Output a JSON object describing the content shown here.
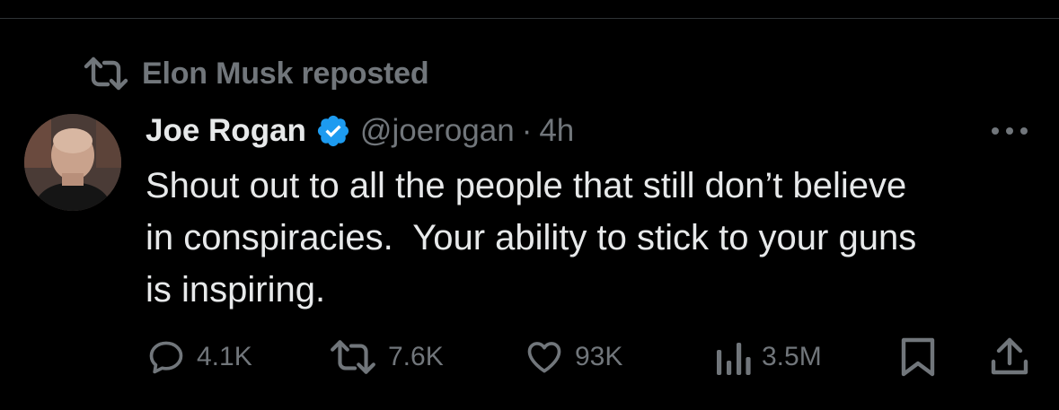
{
  "repost": {
    "text": "Elon Musk reposted",
    "icon": "repost-icon"
  },
  "tweet": {
    "display_name": "Joe Rogan",
    "verified_icon": "verified-badge-icon",
    "handle": "@joerogan",
    "separator": "·",
    "time": "4h",
    "text": "Shout out to all the people that still don’t believe\nin conspiracies.  Your ability to stick to your guns\nis inspiring.",
    "more_icon": "more-icon"
  },
  "actions": {
    "replies": "4.1K",
    "reposts": "7.6K",
    "likes": "93K",
    "views": "3.5M",
    "icons": [
      "reply-icon",
      "repost-icon",
      "like-icon",
      "views-icon",
      "bookmark-icon",
      "share-icon"
    ]
  },
  "colors": {
    "background": "#000000",
    "primary_text": "#e7e9ea",
    "secondary_text": "#71767b",
    "verified_blue": "#1d9bf0",
    "divider": "#2f3336"
  }
}
